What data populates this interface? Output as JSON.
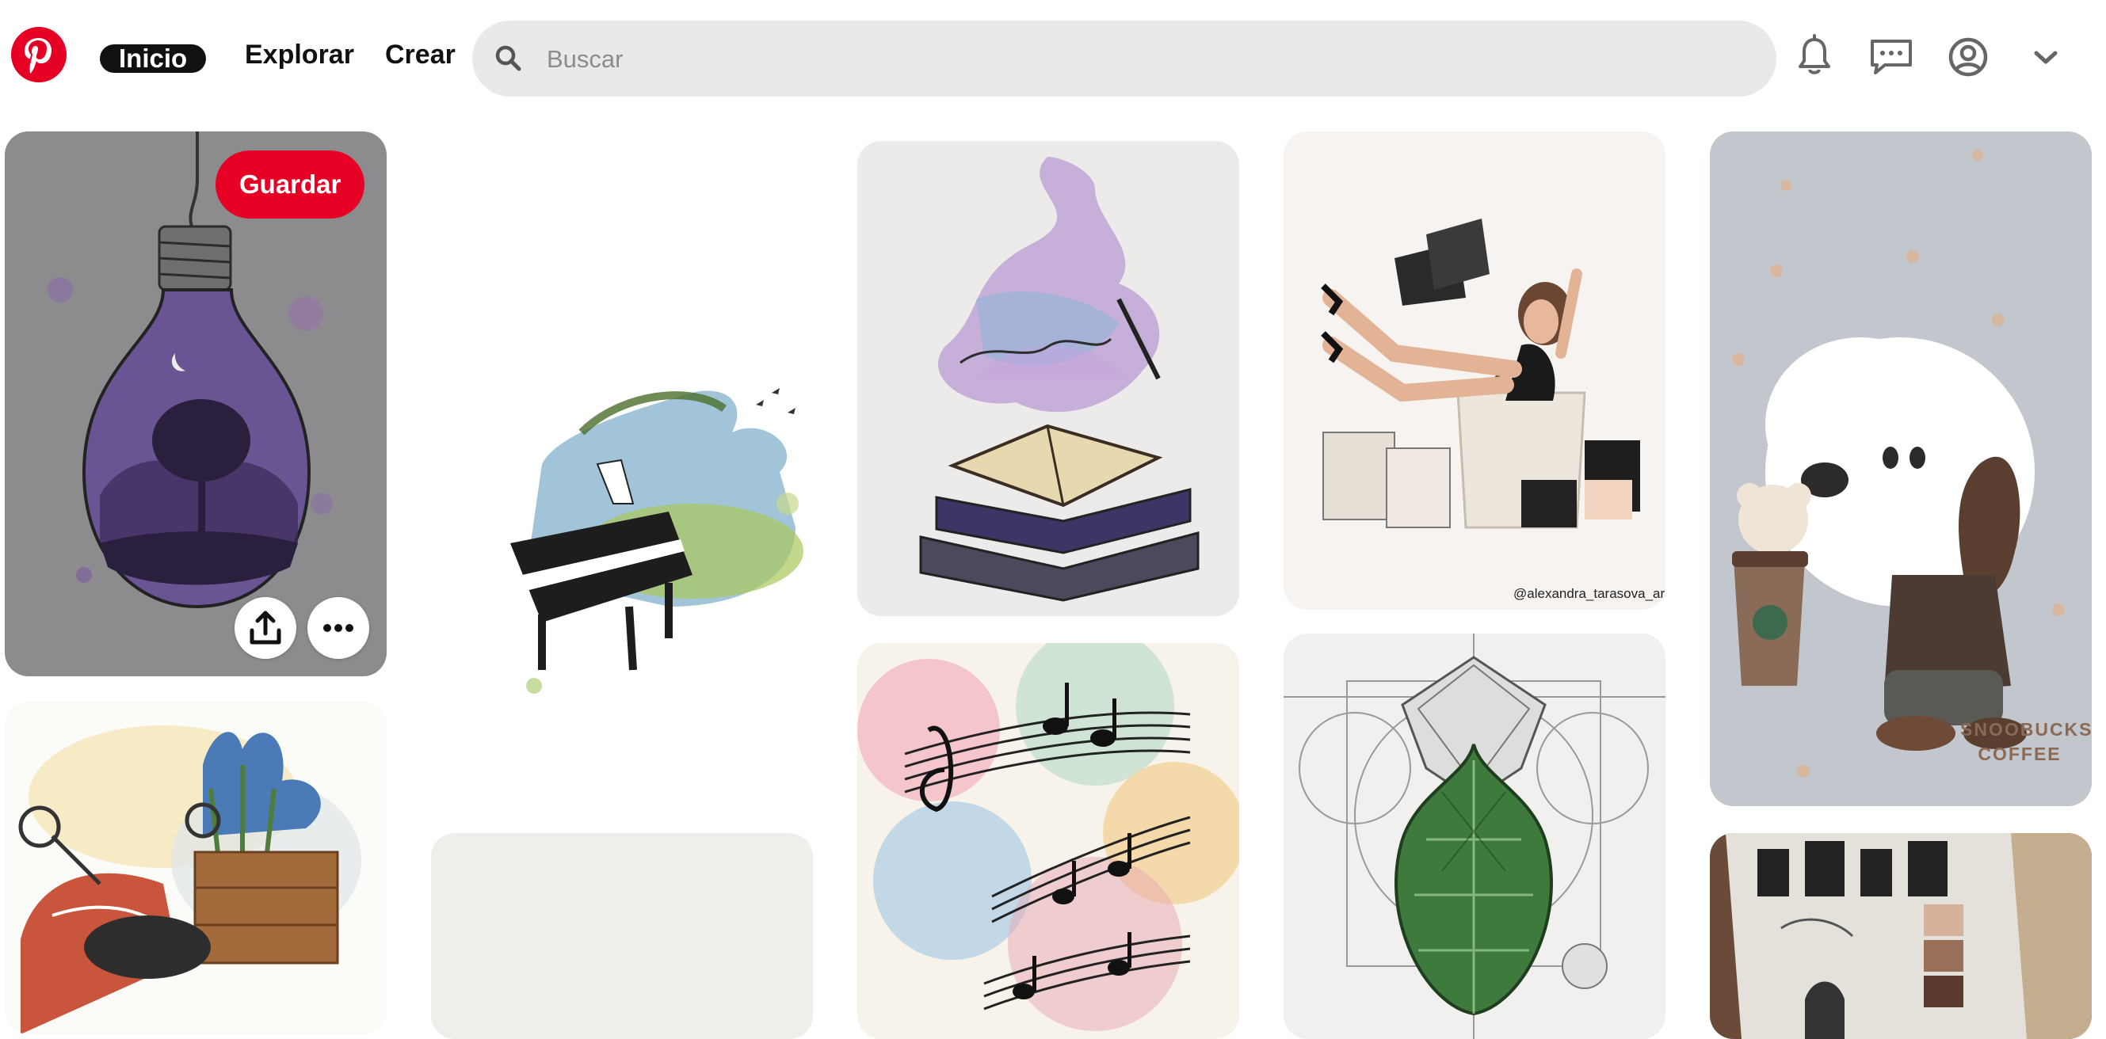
{
  "header": {
    "logo_icon": "pinterest-logo-icon",
    "nav": {
      "home": "Inicio",
      "explore": "Explorar",
      "create": "Crear"
    },
    "search": {
      "placeholder": "Buscar",
      "icon": "search-icon"
    },
    "icons": [
      "bell-icon",
      "message-icon",
      "account-icon",
      "chevron-down-icon"
    ]
  },
  "pins": {
    "save_label": "Guardar",
    "share_icon": "share-icon",
    "more_icon": "more-icon",
    "watermark": "@alexandra_tarasova_art",
    "snoobucks": "SNOOBUCKS\nCOFFEE"
  },
  "colors": {
    "brand": "#e60023",
    "search_bg": "#e9e9e9",
    "text": "#111111"
  }
}
